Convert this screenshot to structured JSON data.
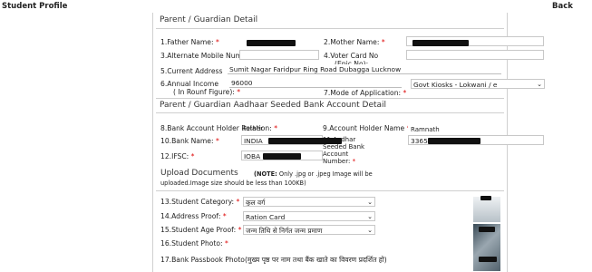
{
  "header": {
    "title": "Student Profile",
    "back": "Back"
  },
  "guardian": {
    "section_title": "Parent / Guardian Detail",
    "father_label": "1.Father Name:",
    "mother_label": "2.Mother Name:",
    "alt_mobile_label": "3.Alternate Mobile Number:",
    "voter_label_1": "4.Voter Card No",
    "voter_label_2": "(Epic No):",
    "address_label": "5.Current Address",
    "address_value": "Sumit Nagar Faridpur  Ring Road Dubagga Lucknow",
    "income_label_1": "6.Annual Income",
    "income_label_2": "( In Rounf Figure):",
    "income_value": "96000",
    "application_select": "Govt Kiosks - Lokwani / e",
    "application_label": "7.Mode of Application:"
  },
  "aadhaar": {
    "section_title": "Parent / Guardian Aadhaar Seeded Bank Account Detail",
    "relation_label": "8.Bank Account Holder Relation:",
    "relation_value": "Father",
    "holder_label": "9.Account Holder Name",
    "holder_value": "Ramnath",
    "bank_label": "10.Bank Name:",
    "bank_value": "INDIA",
    "aadhaar_seeded_label_1": "11.Aadhar",
    "aadhaar_seeded_label_2": "Seeded Bank",
    "aadhaar_seeded_label_3": "Account",
    "aadhaar_seeded_label_4": "Number:",
    "aadhaar_value": "3365",
    "ifsc_label": "12.IFSC:",
    "ifsc_value": "IOBA"
  },
  "upload": {
    "title": "Upload Documents",
    "note_bold": "(NOTE:",
    "note_text": " Only .jpg or .jpeg Image will be",
    "note_line2": "uploaded.Image size should be less than 100KB)",
    "caste_label": "13.Student Category:",
    "caste_value": "कुल वर्ग",
    "address_proof_label": "14.Address Proof:",
    "address_proof_value": "Ration Card",
    "age_proof_label": "15.Student Age Proof:",
    "age_proof_value": "जन्म तिथि से निर्गत जन्म प्रमाण",
    "photo_label": "16.Student Photo:",
    "passbook_label": "17.Bank Passbook Photo",
    "passbook_hint": "(मुख्य पृष्ठ पर नाम तथा बैंक खाते का विवरण प्रदर्शित हो)"
  },
  "req": "*",
  "select_arrow": "⌄"
}
